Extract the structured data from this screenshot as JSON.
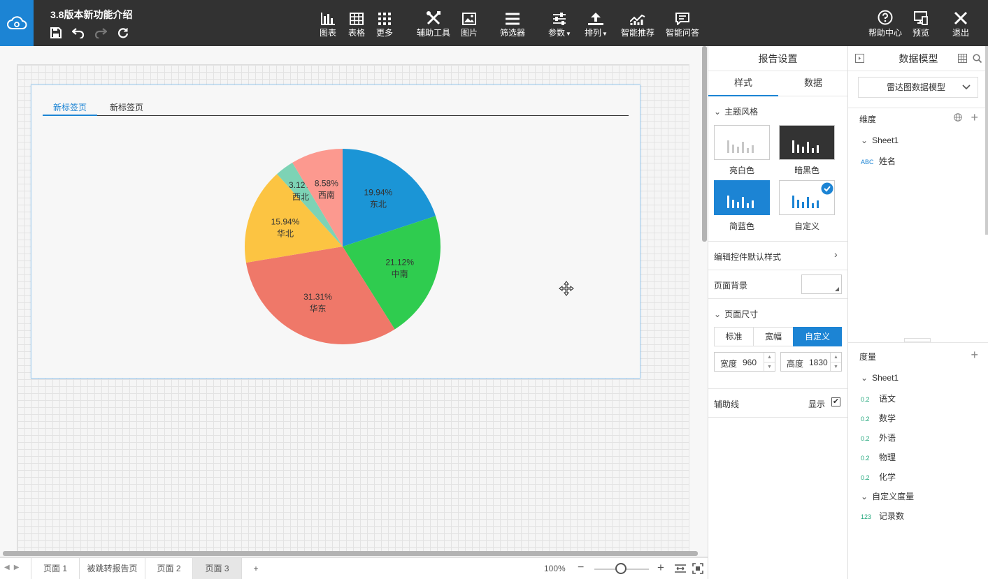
{
  "app": {
    "doc_title": "3.8版本新功能介绍"
  },
  "toolbar": {
    "chart": "图表",
    "table": "表格",
    "more": "更多",
    "aux_tools": "辅助工具",
    "image": "图片",
    "filter": "筛选器",
    "params": "参数",
    "arrange": "排列",
    "smart_recommend": "智能推荐",
    "smart_qa": "智能问答",
    "help": "帮助中心",
    "preview": "预览",
    "exit": "退出"
  },
  "canvas": {
    "tabs": [
      "新标签页",
      "新标签页"
    ]
  },
  "chart_data": {
    "type": "pie",
    "slices": [
      {
        "label": "东北",
        "value": 19.94,
        "pct": "19.94%",
        "color": "#1b95d6"
      },
      {
        "label": "中南",
        "value": 21.12,
        "pct": "21.12%",
        "color": "#2fcc4f"
      },
      {
        "label": "华东",
        "value": 31.31,
        "pct": "31.31%",
        "color": "#ef7869"
      },
      {
        "label": "华北",
        "value": 15.94,
        "pct": "15.94%",
        "color": "#fcc442"
      },
      {
        "label": "西北",
        "value": 3.12,
        "pct": "3.12%",
        "color": "#7dd3b5"
      },
      {
        "label": "西南",
        "value": 8.58,
        "pct": "8.58%",
        "color": "#fc998f"
      }
    ]
  },
  "pagebar": {
    "pages": [
      "页面 1",
      "被跳转报告页",
      "页面 2",
      "页面 3"
    ],
    "active_page": 3,
    "add": "+",
    "zoom": "100%",
    "zoom_minus": "−",
    "zoom_plus": "+"
  },
  "settings": {
    "title": "报告设置",
    "tab_style": "样式",
    "tab_data": "数据",
    "theme_section": "主题风格",
    "themes": [
      "亮白色",
      "暗黑色",
      "简蓝色",
      "自定义"
    ],
    "selected_theme": "自定义",
    "edit_default_style": "编辑控件默认样式",
    "page_bg": "页面背景",
    "page_size": "页面尺寸",
    "size_options": [
      "标准",
      "宽幅",
      "自定义"
    ],
    "selected_size": "自定义",
    "width_label": "宽度",
    "width_value": "960",
    "height_label": "高度",
    "height_value": "1830",
    "guides": "辅助线",
    "show": "显示",
    "show_checked": true
  },
  "model": {
    "title": "数据模型",
    "selected_model": "雷达图数据模型",
    "dimension": "维度",
    "dim_group": "Sheet1",
    "dim_fields": [
      {
        "type": "ABC",
        "name": "姓名"
      }
    ],
    "measure": "度量",
    "measure_group": "Sheet1",
    "measure_fields": [
      {
        "type": "0.2",
        "name": "语文"
      },
      {
        "type": "0.2",
        "name": "数学"
      },
      {
        "type": "0.2",
        "name": "外语"
      },
      {
        "type": "0.2",
        "name": "物理"
      },
      {
        "type": "0.2",
        "name": "化学"
      }
    ],
    "custom_group": "自定义度量",
    "custom_fields": [
      {
        "type": "123",
        "name": "记录数"
      }
    ]
  }
}
